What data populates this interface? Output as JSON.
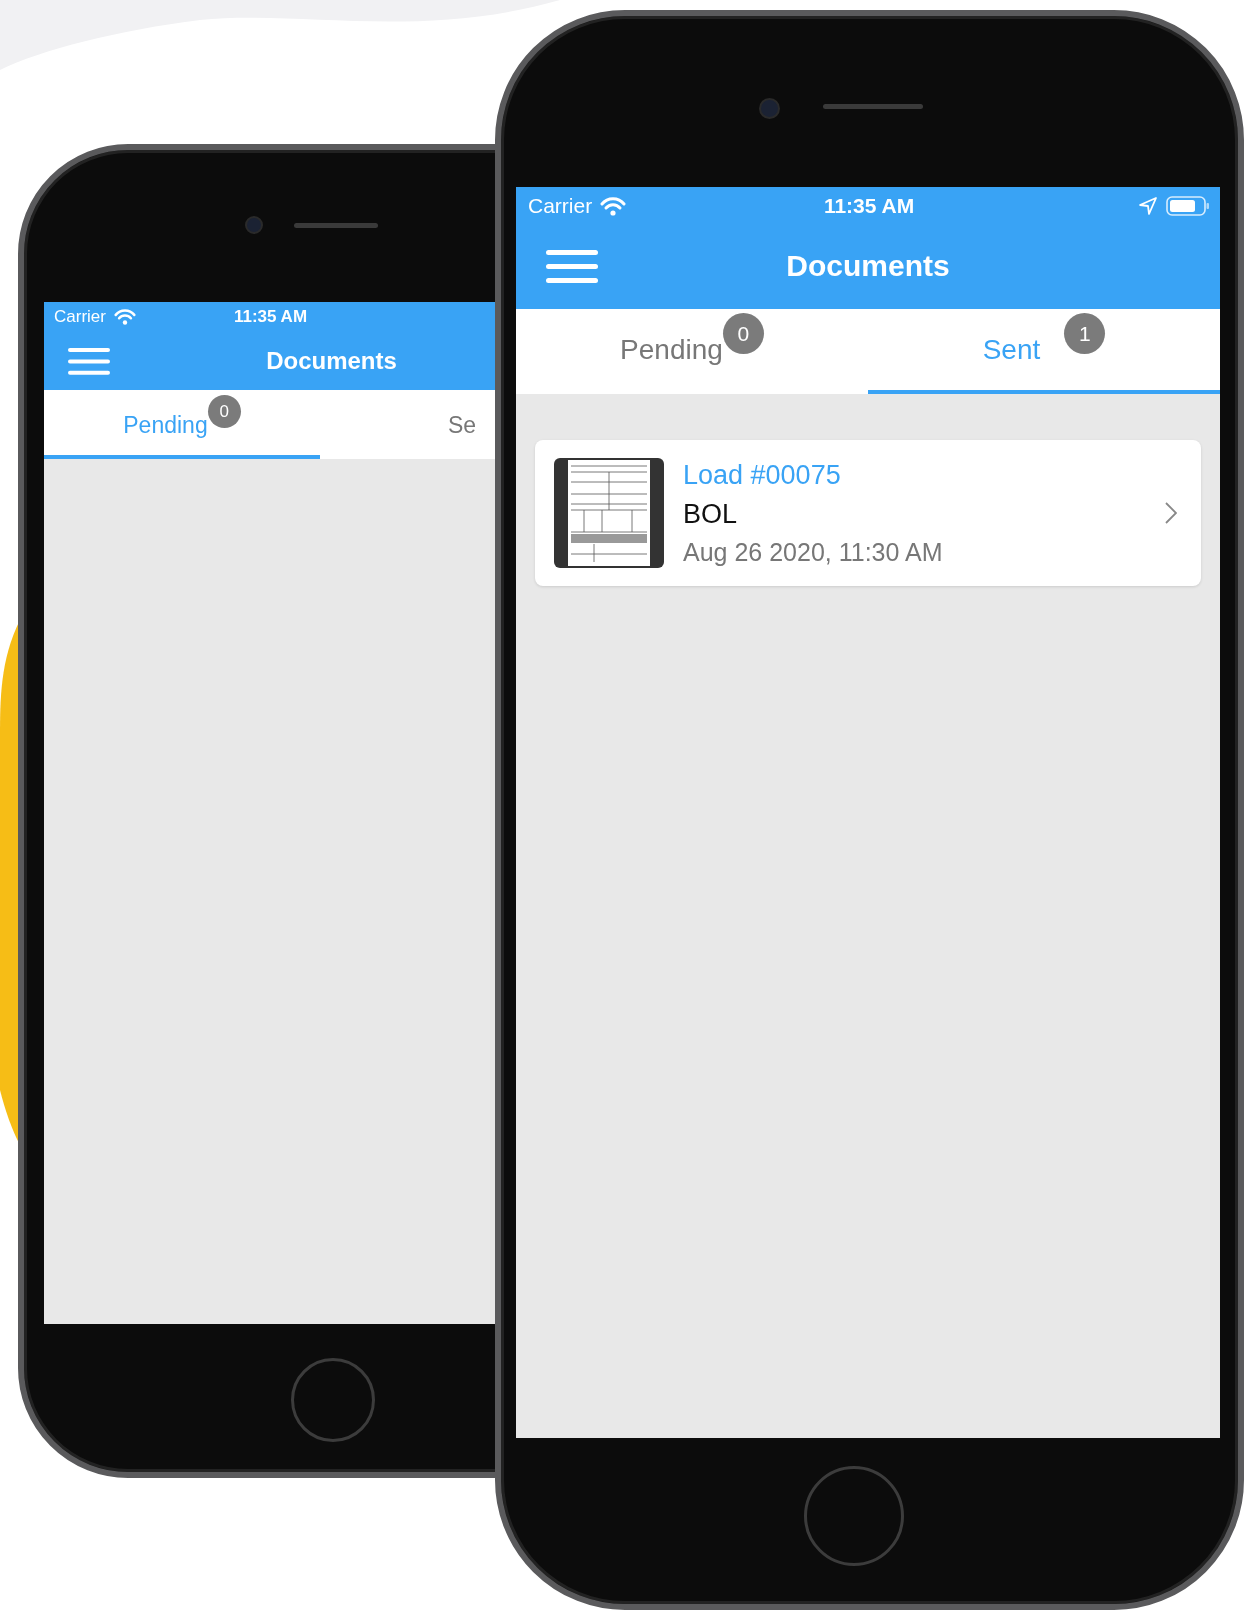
{
  "phones": [
    {
      "kind": "partial",
      "status_bar": {
        "carrier": "Carrier",
        "time": "11:35 AM"
      },
      "nav": {
        "title": "Documents"
      },
      "tabs": [
        {
          "label": "Pending",
          "badge": "0",
          "selected": true
        },
        {
          "label": "Se",
          "selected": false
        }
      ]
    },
    {
      "kind": "full",
      "status_bar": {
        "carrier": "Carrier",
        "time": "11:35 AM"
      },
      "nav": {
        "title": "Documents"
      },
      "tabs": [
        {
          "label": "Pending",
          "badge": "0",
          "selected": false
        },
        {
          "label": "Sent",
          "badge": "1",
          "selected": true
        }
      ],
      "documents": [
        {
          "load": "Load #00075",
          "type": "BOL",
          "date": "Aug 26 2020, 11:30 AM"
        }
      ]
    }
  ]
}
